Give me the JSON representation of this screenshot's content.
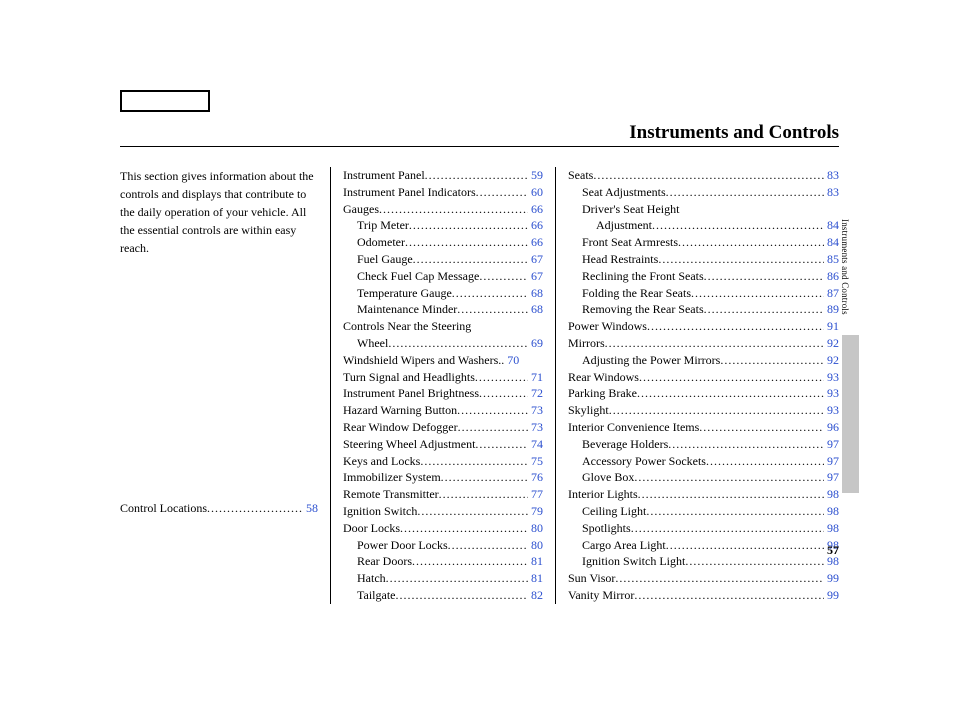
{
  "title": "Instruments and Controls",
  "intro": "This section gives information about the controls and displays that contribute to the daily operation of your vehicle. All the essential controls are within easy reach.",
  "page_number": "57",
  "side_tab_label": "Instruments and Controls",
  "col1_tail": {
    "label": "Control Locations",
    "page": "58"
  },
  "col2": [
    {
      "label": "Instrument Panel",
      "page": "59",
      "i": 0
    },
    {
      "label": "Instrument Panel Indicators",
      "page": "60",
      "i": 0
    },
    {
      "label": "Gauges",
      "page": "66",
      "i": 0
    },
    {
      "label": "Trip Meter",
      "page": "66",
      "i": 1
    },
    {
      "label": "Odometer",
      "page": "66",
      "i": 1
    },
    {
      "label": "Fuel Gauge",
      "page": "67",
      "i": 1
    },
    {
      "label": "Check Fuel Cap Message",
      "page": "67",
      "i": 1
    },
    {
      "label": "Temperature Gauge",
      "page": "68",
      "i": 1
    },
    {
      "label": "Maintenance Minder",
      "page": "68",
      "i": 1
    },
    {
      "label": "Controls Near the Steering",
      "cont": "Wheel",
      "page": "69",
      "i": 0,
      "ci": 1
    },
    {
      "label": "Windshield Wipers and Washers",
      "page": "70",
      "i": 0,
      "nodots": true
    },
    {
      "label": "Turn Signal and Headlights",
      "page": "71",
      "i": 0
    },
    {
      "label": "Instrument Panel Brightness",
      "page": "72",
      "i": 0
    },
    {
      "label": "Hazard Warning Button",
      "page": "73",
      "i": 0
    },
    {
      "label": "Rear Window Defogger",
      "page": "73",
      "i": 0
    },
    {
      "label": "Steering Wheel Adjustment",
      "page": "74",
      "i": 0
    },
    {
      "label": "Keys and Locks",
      "page": "75",
      "i": 0
    },
    {
      "label": "Immobilizer System",
      "page": "76",
      "i": 0
    },
    {
      "label": "Remote Transmitter",
      "page": "77",
      "i": 0
    },
    {
      "label": "Ignition Switch",
      "page": "79",
      "i": 0
    },
    {
      "label": "Door Locks",
      "page": "80",
      "i": 0
    },
    {
      "label": "Power Door Locks",
      "page": "80",
      "i": 1
    },
    {
      "label": "Rear Doors",
      "page": "81",
      "i": 1
    },
    {
      "label": "Hatch",
      "page": "81",
      "i": 1
    },
    {
      "label": "Tailgate",
      "page": "82",
      "i": 1
    }
  ],
  "col3": [
    {
      "label": "Seats",
      "page": "83",
      "i": 0
    },
    {
      "label": "Seat Adjustments",
      "page": "83",
      "i": 1
    },
    {
      "label": "Driver's Seat Height",
      "cont": "Adjustment",
      "page": "84",
      "i": 1,
      "ci": 2
    },
    {
      "label": "Front Seat Armrests",
      "page": "84",
      "i": 1
    },
    {
      "label": "Head Restraints",
      "page": "85",
      "i": 1
    },
    {
      "label": "Reclining the Front Seats",
      "page": "86",
      "i": 1
    },
    {
      "label": "Folding the Rear Seats",
      "page": "87",
      "i": 1
    },
    {
      "label": "Removing the Rear Seats",
      "page": "89",
      "i": 1
    },
    {
      "label": "Power Windows",
      "page": "91",
      "i": 0
    },
    {
      "label": "Mirrors",
      "page": "92",
      "i": 0
    },
    {
      "label": "Adjusting the Power Mirrors",
      "page": "92",
      "i": 1
    },
    {
      "label": "Rear Windows",
      "page": "93",
      "i": 0
    },
    {
      "label": "Parking Brake",
      "page": "93",
      "i": 0
    },
    {
      "label": "Skylight",
      "page": "93",
      "i": 0
    },
    {
      "label": "Interior Convenience Items",
      "page": "96",
      "i": 0
    },
    {
      "label": "Beverage Holders",
      "page": "97",
      "i": 1
    },
    {
      "label": "Accessory Power Sockets",
      "page": "97",
      "i": 1
    },
    {
      "label": "Glove Box",
      "page": "97",
      "i": 1
    },
    {
      "label": "Interior Lights",
      "page": "98",
      "i": 0
    },
    {
      "label": "Ceiling Light",
      "page": "98",
      "i": 1
    },
    {
      "label": "Spotlights",
      "page": "98",
      "i": 1
    },
    {
      "label": "Cargo Area Light",
      "page": "98",
      "i": 1
    },
    {
      "label": "Ignition Switch Light",
      "page": "98",
      "i": 1
    },
    {
      "label": "Sun Visor",
      "page": "99",
      "i": 0
    },
    {
      "label": "Vanity Mirror",
      "page": "99",
      "i": 0
    }
  ]
}
